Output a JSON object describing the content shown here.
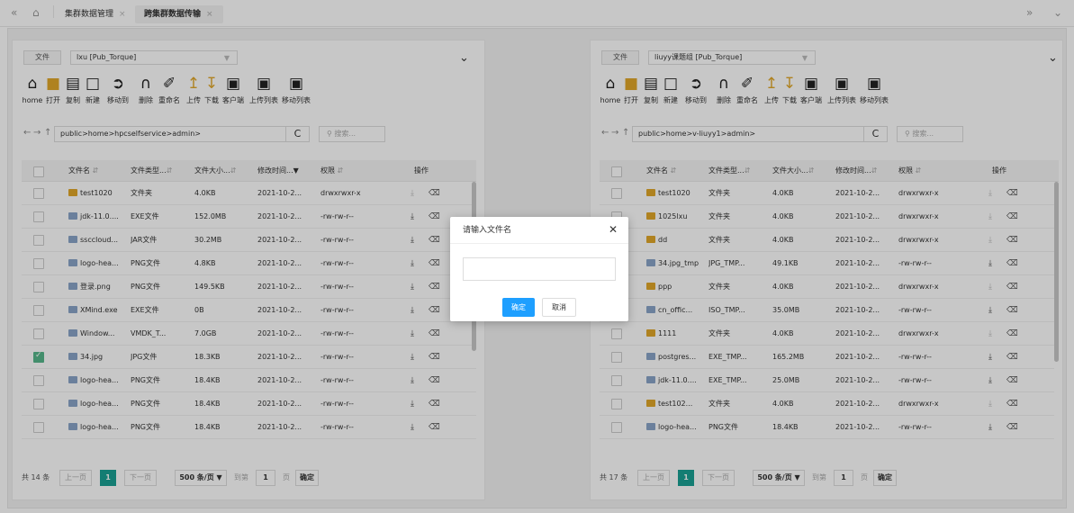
{
  "topbar": {
    "back_icon": "double-chevron-left-icon",
    "home_icon": "home-outline-icon",
    "tabs": [
      {
        "label": "集群数据管理",
        "active": false
      },
      {
        "label": "跨集群数据传输",
        "active": true
      }
    ],
    "tab_close": "×",
    "right_icons": [
      "double-chevron-right-icon",
      "chevron-down-icon"
    ]
  },
  "toolbar_labels": {
    "source_button": "文件",
    "tools": [
      "home",
      "打开",
      "复制",
      "新建",
      "移动到",
      "删除",
      "重命名",
      "上传",
      "下载",
      "客户端",
      "上传列表",
      "移动列表"
    ]
  },
  "columns": [
    "文件名",
    "文件类型...",
    "文件大小...",
    "修改时间...",
    "权限",
    "操作"
  ],
  "search_placeholder": "搜索...",
  "pager_labels": {
    "prev": "上一页",
    "next": "下一页",
    "page_size": "500 条/页",
    "goto": "到第",
    "page_unit": "页",
    "confirm": "确定",
    "current": "1",
    "goto_value": "1"
  },
  "left": {
    "selected_source": "lxu  [Pub_Torque]",
    "path": "public>home>hpcselfservice>admin>",
    "total": "共 14 条",
    "rows": [
      {
        "name": "test1020",
        "type": "文件夹",
        "size": "4.0KB",
        "time": "2021-10-2...",
        "perm": "drwxrwxr-x",
        "folder": true,
        "checked": false
      },
      {
        "name": "jdk-11.0....",
        "type": "EXE文件",
        "size": "152.0MB",
        "time": "2021-10-2...",
        "perm": "-rw-rw-r--",
        "folder": false,
        "checked": false
      },
      {
        "name": "ssccloud...",
        "type": "JAR文件",
        "size": "30.2MB",
        "time": "2021-10-2...",
        "perm": "-rw-rw-r--",
        "folder": false,
        "checked": false
      },
      {
        "name": "logo-hea...",
        "type": "PNG文件",
        "size": "4.8KB",
        "time": "2021-10-2...",
        "perm": "-rw-rw-r--",
        "folder": false,
        "checked": false
      },
      {
        "name": "登录.png",
        "type": "PNG文件",
        "size": "149.5KB",
        "time": "2021-10-2...",
        "perm": "-rw-rw-r--",
        "folder": false,
        "checked": false
      },
      {
        "name": "XMind.exe",
        "type": "EXE文件",
        "size": "0B",
        "time": "2021-10-2...",
        "perm": "-rw-rw-r--",
        "folder": false,
        "checked": false
      },
      {
        "name": "Window...",
        "type": "VMDK_T...",
        "size": "7.0GB",
        "time": "2021-10-2...",
        "perm": "-rw-rw-r--",
        "folder": false,
        "checked": false
      },
      {
        "name": "34.jpg",
        "type": "JPG文件",
        "size": "18.3KB",
        "time": "2021-10-2...",
        "perm": "-rw-rw-r--",
        "folder": false,
        "checked": true
      },
      {
        "name": "logo-hea...",
        "type": "PNG文件",
        "size": "18.4KB",
        "time": "2021-10-2...",
        "perm": "-rw-rw-r--",
        "folder": false,
        "checked": false
      },
      {
        "name": "logo-hea...",
        "type": "PNG文件",
        "size": "18.4KB",
        "time": "2021-10-2...",
        "perm": "-rw-rw-r--",
        "folder": false,
        "checked": false
      },
      {
        "name": "logo-hea...",
        "type": "PNG文件",
        "size": "18.4KB",
        "time": "2021-10-2...",
        "perm": "-rw-rw-r--",
        "folder": false,
        "checked": false
      }
    ]
  },
  "right": {
    "selected_source": "liuyy课题组  [Pub_Torque]",
    "path": "public>home>v-liuyy1>admin>",
    "total": "共 17 条",
    "rows": [
      {
        "name": "test1020",
        "type": "文件夹",
        "size": "4.0KB",
        "time": "2021-10-2...",
        "perm": "drwxrwxr-x",
        "folder": true
      },
      {
        "name": "1025lxu",
        "type": "文件夹",
        "size": "4.0KB",
        "time": "2021-10-2...",
        "perm": "drwxrwxr-x",
        "folder": true
      },
      {
        "name": "dd",
        "type": "文件夹",
        "size": "4.0KB",
        "time": "2021-10-2...",
        "perm": "drwxrwxr-x",
        "folder": true
      },
      {
        "name": "34.jpg_tmp",
        "type": "JPG_TMP...",
        "size": "49.1KB",
        "time": "2021-10-2...",
        "perm": "-rw-rw-r--",
        "folder": false
      },
      {
        "name": "ppp",
        "type": "文件夹",
        "size": "4.0KB",
        "time": "2021-10-2...",
        "perm": "drwxrwxr-x",
        "folder": true
      },
      {
        "name": "cn_offic...",
        "type": "ISO_TMP...",
        "size": "35.0MB",
        "time": "2021-10-2...",
        "perm": "-rw-rw-r--",
        "folder": false
      },
      {
        "name": "1111",
        "type": "文件夹",
        "size": "4.0KB",
        "time": "2021-10-2...",
        "perm": "drwxrwxr-x",
        "folder": true
      },
      {
        "name": "postgres...",
        "type": "EXE_TMP...",
        "size": "165.2MB",
        "time": "2021-10-2...",
        "perm": "-rw-rw-r--",
        "folder": false
      },
      {
        "name": "jdk-11.0....",
        "type": "EXE_TMP...",
        "size": "25.0MB",
        "time": "2021-10-2...",
        "perm": "-rw-rw-r--",
        "folder": false
      },
      {
        "name": "test102...",
        "type": "文件夹",
        "size": "4.0KB",
        "time": "2021-10-2...",
        "perm": "drwxrwxr-x",
        "folder": true
      },
      {
        "name": "logo-hea...",
        "type": "PNG文件",
        "size": "18.4KB",
        "time": "2021-10-2...",
        "perm": "-rw-rw-r--",
        "folder": false
      }
    ]
  },
  "modal": {
    "title": "请输入文件名",
    "input_value": "",
    "confirm": "确定",
    "cancel": "取消"
  },
  "colors": {
    "accent": "#1aa094",
    "primary_button": "#1e9fff",
    "checkbox_checked": "#56b68b",
    "folder": "#e0a72a",
    "upload_icon": "#e0a72a",
    "overlay": "rgba(0,0,0,0.22)"
  }
}
